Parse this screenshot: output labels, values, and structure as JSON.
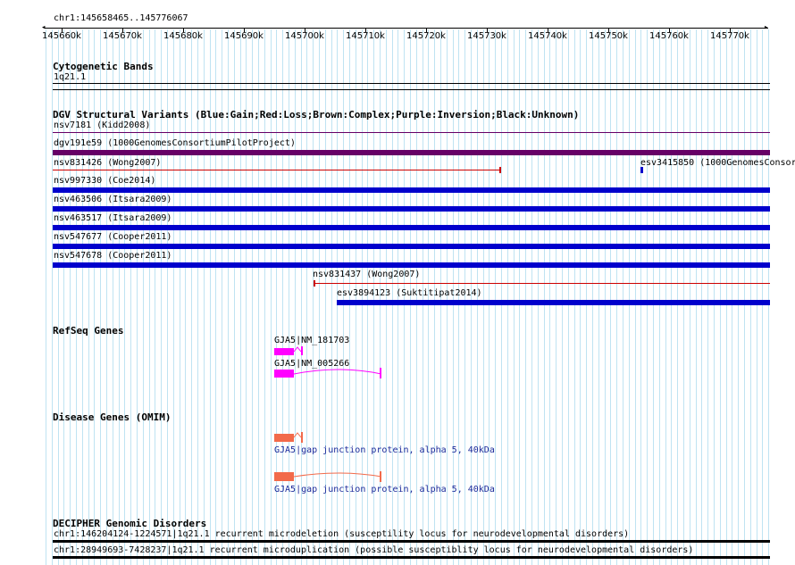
{
  "ruler": {
    "location": "chr1:145658465..145776067",
    "ticks": [
      "145660k",
      "145670k",
      "145680k",
      "145690k",
      "145700k",
      "145710k",
      "145720k",
      "145730k",
      "145740k",
      "145750k",
      "145760k",
      "145770k"
    ]
  },
  "cytoband": {
    "title": "Cytogenetic Bands",
    "band": "1q21.1"
  },
  "dgv": {
    "title": "DGV Structural Variants (Blue:Gain;Red:Loss;Brown:Complex;Purple:Inversion;Black:Unknown)",
    "variants": [
      {
        "label": "nsv7181 (Kidd2008)",
        "type": "inversion-line"
      },
      {
        "label": "dgv191e59 (1000GenomesConsortiumPilotProject)",
        "type": "inversion"
      },
      {
        "label": "nsv831426 (Wong2007)",
        "type": "loss"
      },
      {
        "label": "esv3415850 (1000GenomesConsor",
        "type": "gain"
      },
      {
        "label": "nsv997330 (Coe2014)",
        "type": "gain"
      },
      {
        "label": "nsv463506 (Itsara2009)",
        "type": "gain"
      },
      {
        "label": "nsv463517 (Itsara2009)",
        "type": "gain"
      },
      {
        "label": "nsv547677 (Cooper2011)",
        "type": "gain"
      },
      {
        "label": "nsv547678 (Cooper2011)",
        "type": "gain"
      },
      {
        "label": "nsv831437 (Wong2007)",
        "type": "loss"
      },
      {
        "label": "esv3894123 (Suktitipat2014)",
        "type": "gain"
      }
    ]
  },
  "refseq": {
    "title": "RefSeq Genes",
    "genes": [
      "GJA5|NM_181703",
      "GJA5|NM_005266"
    ]
  },
  "omim": {
    "title": "Disease Genes (OMIM)",
    "genes": [
      "GJA5|gap junction protein, alpha 5, 40kDa",
      "GJA5|gap junction protein, alpha 5, 40kDa"
    ]
  },
  "decipher": {
    "title": "DECIPHER Genomic Disorders",
    "items": [
      "chr1:146204124-1224571|1q21.1 recurrent microdeletion (susceptility locus for neurodevelopmental disorders)",
      "chr1:28949693-7428237|1q21.1 recurrent microduplication (possible susceptiblity locus for neurodevelopmental disorders)"
    ]
  },
  "colors": {
    "gain": "#0000cc",
    "loss": "#cc0000",
    "inversion": "#660066",
    "gene": "#ff00ff",
    "omim": "#f26a4a",
    "grid": "#bfe3f2"
  }
}
